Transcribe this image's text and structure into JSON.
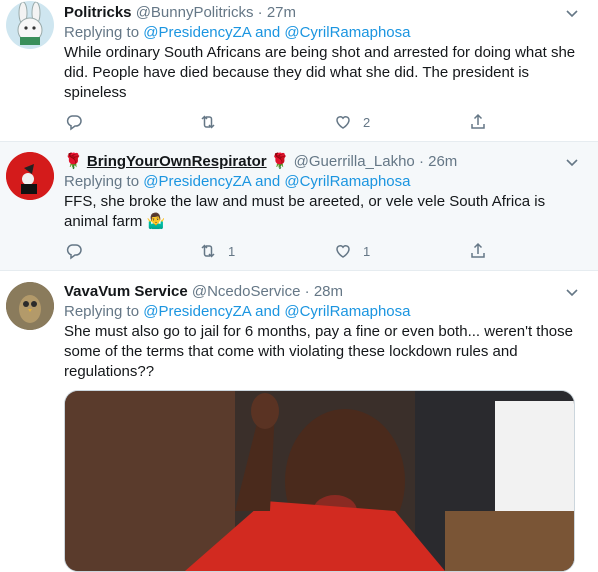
{
  "tweets": [
    {
      "name": "Politricks",
      "handle": "@BunnyPolitricks",
      "dot": "·",
      "time": "27m",
      "replying_prefix": "Replying to",
      "mention1": "@PresidencyZA",
      "and": "and",
      "mention2": "@CyrilRamaphosa",
      "text": "While ordinary South Africans are being shot and arrested for doing what she did. People have died because they did what she did. The president is spineless",
      "replies": "",
      "retweets": "",
      "likes": "2"
    },
    {
      "name_prefix_emoji": "🌹",
      "name": "BringYourOwnRespirator",
      "name_suffix_emoji": "🌹",
      "handle": "@Guerrilla_Lakho",
      "dot": "·",
      "time": "26m",
      "replying_prefix": "Replying to",
      "mention1": "@PresidencyZA",
      "and": "and",
      "mention2": "@CyrilRamaphosa",
      "text": "FFS, she broke the law and must be areeted, or vele vele South Africa is animal farm",
      "text_emoji": "🤷‍♂️",
      "replies": "",
      "retweets": "1",
      "likes": "1"
    },
    {
      "name": "VavaVum Service",
      "handle": "@NcedoService",
      "dot": "·",
      "time": "28m",
      "replying_prefix": "Replying to",
      "mention1": "@PresidencyZA",
      "and": "and",
      "mention2": "@CyrilRamaphosa",
      "text": "She must also go to jail for 6 months, pay a fine or even both... weren't those some of the terms that come with violating these lockdown rules and regulations??"
    }
  ],
  "colors": {
    "link": "#1b95e0",
    "muted": "#657786",
    "hover_bg": "#f5f8fa",
    "border": "#e6ecf0"
  },
  "icons": [
    "reply-icon",
    "retweet-icon",
    "like-icon",
    "share-icon",
    "chevron-down-icon"
  ]
}
